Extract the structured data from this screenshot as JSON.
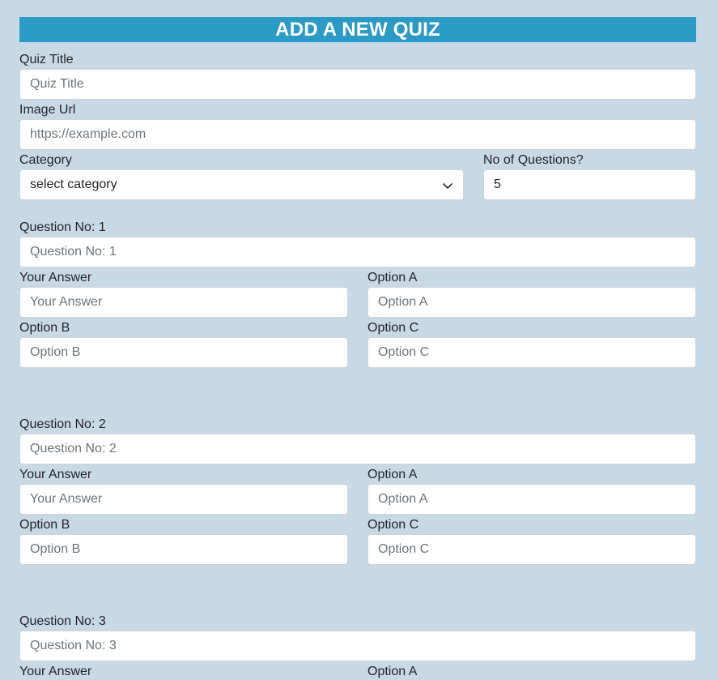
{
  "header": {
    "title": "ADD A NEW QUIZ"
  },
  "quiz_title": {
    "label": "Quiz Title",
    "placeholder": "Quiz Title"
  },
  "image_url": {
    "label": "Image Url",
    "placeholder": "https://example.com"
  },
  "category": {
    "label": "Category",
    "selected": "select category",
    "icon": "chevron-down-icon"
  },
  "num_questions": {
    "label": "No of Questions?",
    "value": "5"
  },
  "questions": [
    {
      "label": "Question No: 1",
      "placeholder": "Question No: 1",
      "answer_label": "Your Answer",
      "answer_placeholder": "Your Answer",
      "option_a_label": "Option A",
      "option_a_placeholder": "Option A",
      "option_b_label": "Option B",
      "option_b_placeholder": "Option B",
      "option_c_label": "Option C",
      "option_c_placeholder": "Option C"
    },
    {
      "label": "Question No: 2",
      "placeholder": "Question No: 2",
      "answer_label": "Your Answer",
      "answer_placeholder": "Your Answer",
      "option_a_label": "Option A",
      "option_a_placeholder": "Option A",
      "option_b_label": "Option B",
      "option_b_placeholder": "Option B",
      "option_c_label": "Option C",
      "option_c_placeholder": "Option C"
    },
    {
      "label": "Question No: 3",
      "placeholder": "Question No: 3",
      "answer_label": "Your Answer",
      "option_a_label": "Option A"
    }
  ]
}
